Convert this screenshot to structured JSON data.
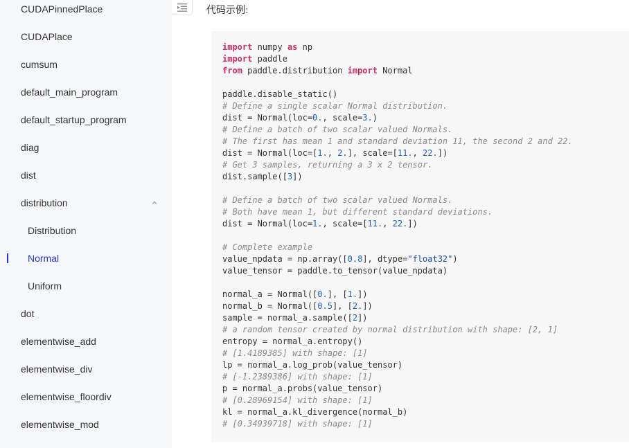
{
  "sidebar": {
    "items": [
      {
        "label": "CUDAPinnedPlace",
        "level": 0,
        "active": false
      },
      {
        "label": "CUDAPlace",
        "level": 0,
        "active": false
      },
      {
        "label": "cumsum",
        "level": 0,
        "active": false
      },
      {
        "label": "default_main_program",
        "level": 0,
        "active": false
      },
      {
        "label": "default_startup_program",
        "level": 0,
        "active": false
      },
      {
        "label": "diag",
        "level": 0,
        "active": false
      },
      {
        "label": "dist",
        "level": 0,
        "active": false
      },
      {
        "label": "distribution",
        "level": 0,
        "active": false,
        "expanded": true
      },
      {
        "label": "Distribution",
        "level": 1,
        "active": false
      },
      {
        "label": "Normal",
        "level": 1,
        "active": true
      },
      {
        "label": "Uniform",
        "level": 1,
        "active": false
      },
      {
        "label": "dot",
        "level": 0,
        "active": false
      },
      {
        "label": "elementwise_add",
        "level": 0,
        "active": false
      },
      {
        "label": "elementwise_div",
        "level": 0,
        "active": false
      },
      {
        "label": "elementwise_floordiv",
        "level": 0,
        "active": false
      },
      {
        "label": "elementwise_mod",
        "level": 0,
        "active": false
      }
    ]
  },
  "content": {
    "section_title": "代码示例:",
    "code_lines": [
      [
        {
          "t": "kw",
          "v": "import"
        },
        {
          "t": "",
          "v": " numpy "
        },
        {
          "t": "kw",
          "v": "as"
        },
        {
          "t": "",
          "v": " np"
        }
      ],
      [
        {
          "t": "kw",
          "v": "import"
        },
        {
          "t": "",
          "v": " paddle"
        }
      ],
      [
        {
          "t": "kw",
          "v": "from"
        },
        {
          "t": "",
          "v": " paddle.distribution "
        },
        {
          "t": "kw",
          "v": "import"
        },
        {
          "t": "",
          "v": " Normal"
        }
      ],
      [],
      [
        {
          "t": "",
          "v": "paddle.disable_static()"
        }
      ],
      [
        {
          "t": "com",
          "v": "# Define a single scalar Normal distribution."
        }
      ],
      [
        {
          "t": "",
          "v": "dist = Normal(loc="
        },
        {
          "t": "num",
          "v": "0."
        },
        {
          "t": "",
          "v": ", scale="
        },
        {
          "t": "num",
          "v": "3."
        },
        {
          "t": "",
          "v": ")"
        }
      ],
      [
        {
          "t": "com",
          "v": "# Define a batch of two scalar valued Normals."
        }
      ],
      [
        {
          "t": "com",
          "v": "# The first has mean 1 and standard deviation 11, the second 2 and 22."
        }
      ],
      [
        {
          "t": "",
          "v": "dist = Normal(loc=["
        },
        {
          "t": "num",
          "v": "1."
        },
        {
          "t": "",
          "v": ", "
        },
        {
          "t": "num",
          "v": "2."
        },
        {
          "t": "",
          "v": "], scale=["
        },
        {
          "t": "num",
          "v": "11."
        },
        {
          "t": "",
          "v": ", "
        },
        {
          "t": "num",
          "v": "22."
        },
        {
          "t": "",
          "v": "])"
        }
      ],
      [
        {
          "t": "com",
          "v": "# Get 3 samples, returning a 3 x 2 tensor."
        }
      ],
      [
        {
          "t": "",
          "v": "dist.sample(["
        },
        {
          "t": "num",
          "v": "3"
        },
        {
          "t": "",
          "v": "])"
        }
      ],
      [],
      [
        {
          "t": "com",
          "v": "# Define a batch of two scalar valued Normals."
        }
      ],
      [
        {
          "t": "com",
          "v": "# Both have mean 1, but different standard deviations."
        }
      ],
      [
        {
          "t": "",
          "v": "dist = Normal(loc="
        },
        {
          "t": "num",
          "v": "1."
        },
        {
          "t": "",
          "v": ", scale=["
        },
        {
          "t": "num",
          "v": "11."
        },
        {
          "t": "",
          "v": ", "
        },
        {
          "t": "num",
          "v": "22."
        },
        {
          "t": "",
          "v": "])"
        }
      ],
      [],
      [
        {
          "t": "com",
          "v": "# Complete example"
        }
      ],
      [
        {
          "t": "",
          "v": "value_npdata = np.array(["
        },
        {
          "t": "num",
          "v": "0.8"
        },
        {
          "t": "",
          "v": "], dtype="
        },
        {
          "t": "str",
          "v": "\"float32\""
        },
        {
          "t": "",
          "v": ")"
        }
      ],
      [
        {
          "t": "",
          "v": "value_tensor = paddle.to_tensor(value_npdata)"
        }
      ],
      [],
      [
        {
          "t": "",
          "v": "normal_a = Normal(["
        },
        {
          "t": "num",
          "v": "0."
        },
        {
          "t": "",
          "v": "], ["
        },
        {
          "t": "num",
          "v": "1."
        },
        {
          "t": "",
          "v": "])"
        }
      ],
      [
        {
          "t": "",
          "v": "normal_b = Normal(["
        },
        {
          "t": "num",
          "v": "0.5"
        },
        {
          "t": "",
          "v": "], ["
        },
        {
          "t": "num",
          "v": "2."
        },
        {
          "t": "",
          "v": "])"
        }
      ],
      [
        {
          "t": "",
          "v": "sample = normal_a.sample(["
        },
        {
          "t": "num",
          "v": "2"
        },
        {
          "t": "",
          "v": "])"
        }
      ],
      [
        {
          "t": "com",
          "v": "# a random tensor created by normal distribution with shape: [2, 1]"
        }
      ],
      [
        {
          "t": "",
          "v": "entropy = normal_a.entropy()"
        }
      ],
      [
        {
          "t": "com",
          "v": "# [1.4189385] with shape: [1]"
        }
      ],
      [
        {
          "t": "",
          "v": "lp = normal_a.log_prob(value_tensor)"
        }
      ],
      [
        {
          "t": "com",
          "v": "# [-1.2389386] with shape: [1]"
        }
      ],
      [
        {
          "t": "",
          "v": "p = normal_a.probs(value_tensor)"
        }
      ],
      [
        {
          "t": "com",
          "v": "# [0.28969154] with shape: [1]"
        }
      ],
      [
        {
          "t": "",
          "v": "kl = normal_a.kl_divergence(normal_b)"
        }
      ],
      [
        {
          "t": "com",
          "v": "# [0.34939718] with shape: [1]"
        }
      ]
    ]
  },
  "colors": {
    "active": "#2932e1",
    "keyword": "#cf2e5e",
    "comment": "#8a8a8a",
    "number": "#1f5fbf",
    "sidebar_bg": "#f7f8fa",
    "code_bg": "#f7f7f7"
  },
  "icons": {
    "toggle": "menu-fold-icon",
    "expand": "chevron-up-icon"
  }
}
